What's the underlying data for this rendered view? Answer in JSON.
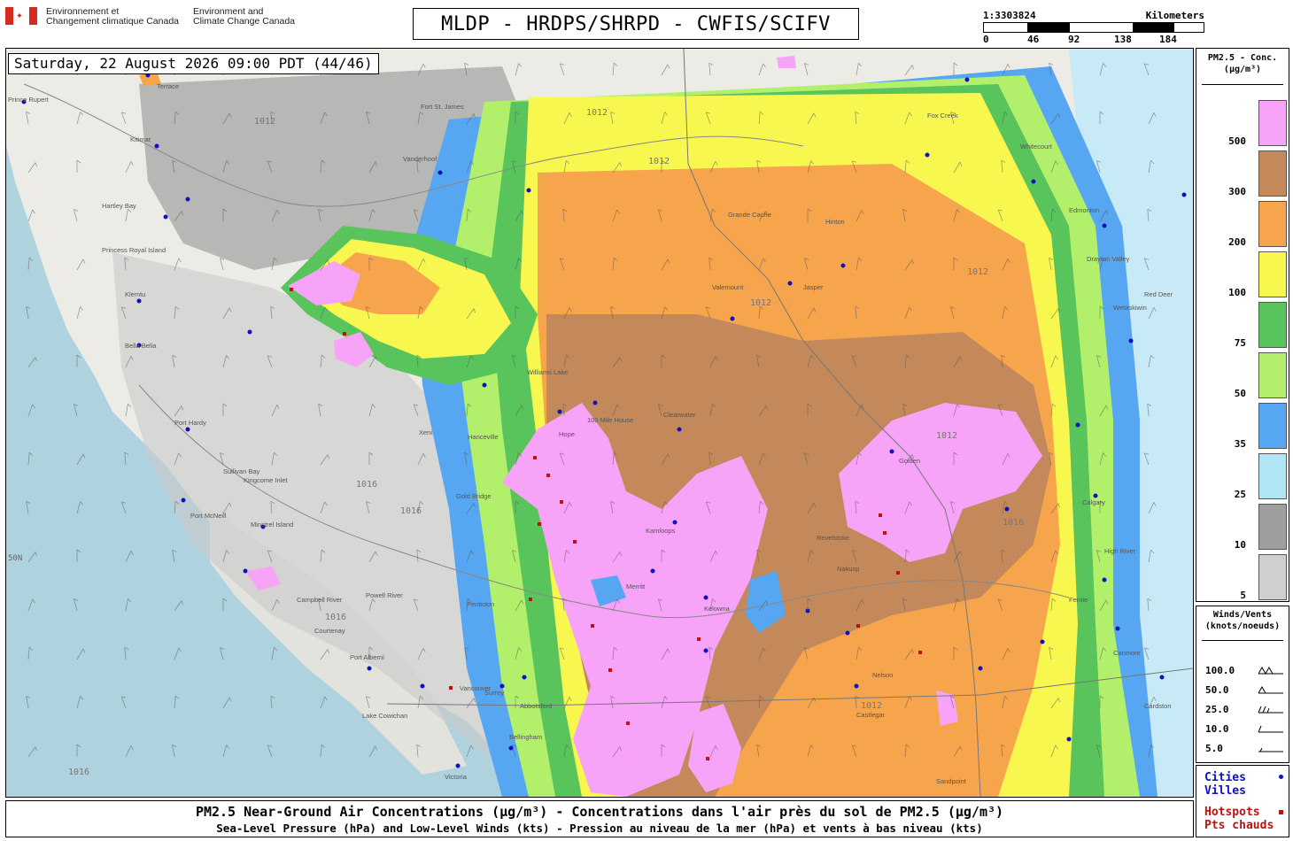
{
  "header": {
    "agency_fr_line1": "Environnement et",
    "agency_fr_line2": "Changement climatique Canada",
    "agency_en_line1": "Environment and",
    "agency_en_line2": "Climate Change Canada",
    "title": "MLDP - HRDPS/SHRPD - CWFIS/SCIFV",
    "scale_ratio": "1:3303824",
    "scale_unit": "Kilometers",
    "scale_ticks": [
      "0",
      "46",
      "92",
      "138",
      "184"
    ]
  },
  "timestamp": "Saturday, 22 August 2026 09:00 PDT (44/46)",
  "legend": {
    "title_line1": "PM2.5 - Conc.",
    "title_line2": "(µg/m³)",
    "classes": [
      {
        "label": "500",
        "color": "#f7a3f7"
      },
      {
        "label": "300",
        "color": "#c4895a"
      },
      {
        "label": "200",
        "color": "#f6a54c"
      },
      {
        "label": "100",
        "color": "#f7f74f"
      },
      {
        "label": "75",
        "color": "#59c45c"
      },
      {
        "label": "50",
        "color": "#b2f06c"
      },
      {
        "label": "35",
        "color": "#56a6f2"
      },
      {
        "label": "25",
        "color": "#b2e6f7"
      },
      {
        "label": "10",
        "color": "#9e9e9e"
      },
      {
        "label": "5",
        "color": "#cfcfcf"
      }
    ]
  },
  "winds": {
    "title_line1": "Winds/Vents",
    "title_line2": "(knots/noeuds)",
    "rows": [
      "100.0",
      "50.0",
      "25.0",
      "10.0",
      "5.0"
    ]
  },
  "markers": {
    "cities_en": "Cities",
    "cities_fr": "Villes",
    "hotspots_en": "Hotspots",
    "hotspots_fr": "Pts chauds",
    "city_color": "#1010c0",
    "hotspot_color": "#c01010"
  },
  "caption": {
    "line1": "PM2.5 Near-Ground Air Concentrations (µg/m³) - Concentrations dans l'air près du sol de PM2.5 (µg/m³)",
    "line2": "Sea-Level Pressure (hPa) and Low-Level Winds (kts) - Pression au niveau de la mer (hPa) et vents à bas niveau (kts)"
  },
  "map_labels": {
    "places": [
      "Terrace",
      "Prince Rupert",
      "Kitimat",
      "Hartley Bay",
      "Princess Royal Island",
      "Klemtu",
      "Bella Bella",
      "Port Hardy",
      "Port McNeill",
      "Sullivan Bay",
      "Kingcome Inlet",
      "Minstrel Island",
      "Campbell River",
      "Powell River",
      "Courtenay",
      "Port Alberni",
      "Lake Cowichan",
      "Victoria",
      "Vancouver",
      "Surrey",
      "Abbotsford",
      "Bellingham",
      "Hope",
      "Gold Bridge",
      "Williams Lake",
      "100 Mile House",
      "Clearwater",
      "Kamloops",
      "Merritt",
      "Kelowna",
      "Penticton",
      "Nakusp",
      "Nelson",
      "Castlegar",
      "Revelstoke",
      "Golden",
      "Valemount",
      "Jasper",
      "Hinton",
      "Grande Cache",
      "Edmonton",
      "Drayton Valley",
      "Red Deer",
      "Calgary",
      "High River",
      "Fernie",
      "Cardston",
      "Canmore",
      "Fort St. James",
      "Vanderhoof",
      "Xeni",
      "Hanceville",
      "Fox Creek",
      "Whitecourt",
      "Wetaskiwin",
      "Sandpoint"
    ],
    "isobars": [
      "1012",
      "1016"
    ],
    "latitude": "50N"
  }
}
